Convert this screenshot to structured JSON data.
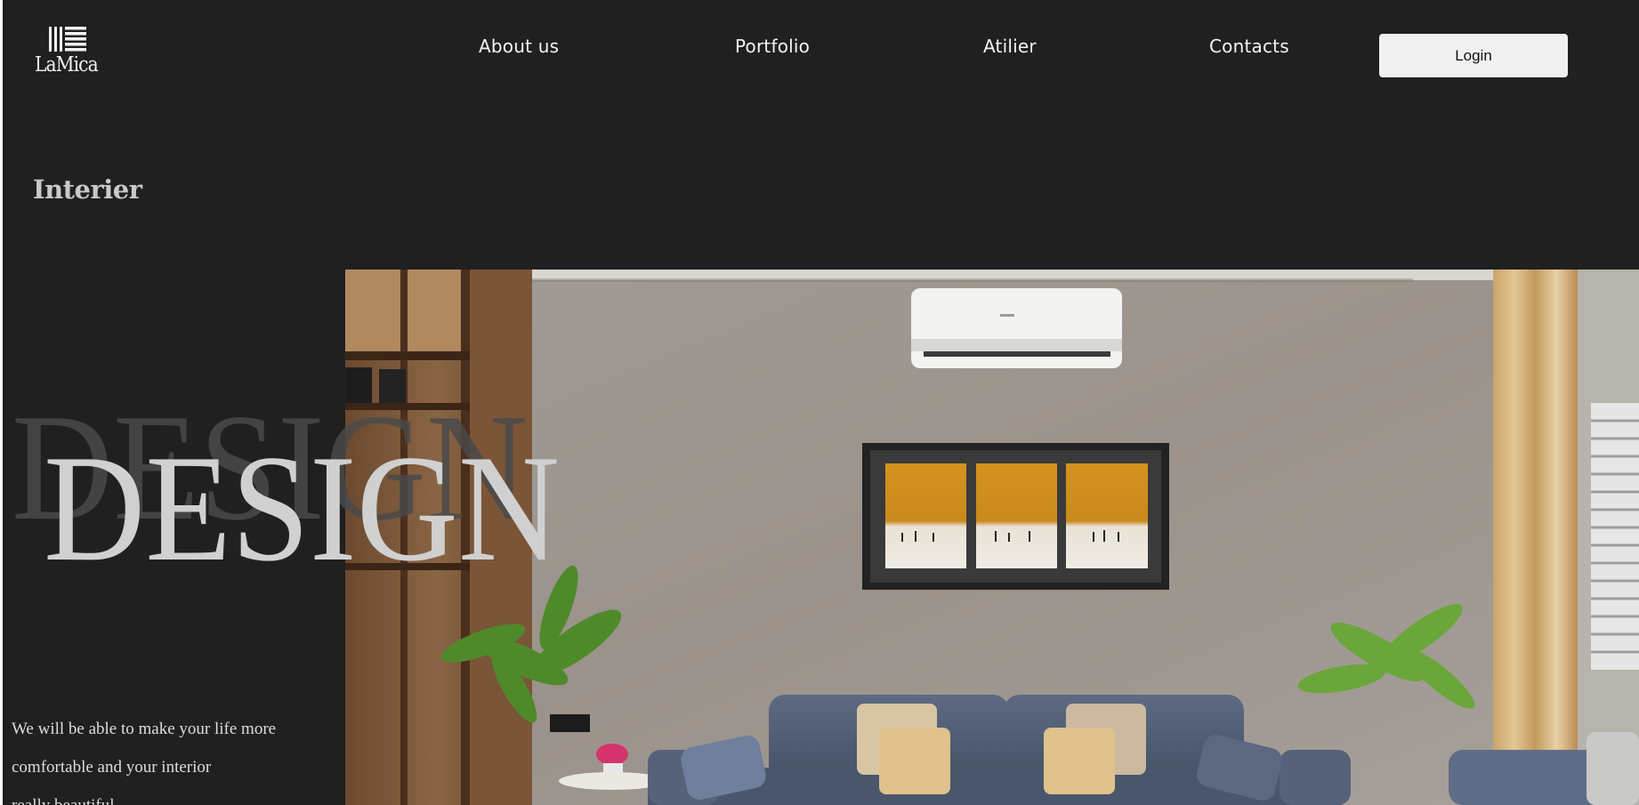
{
  "header": {
    "logo_text": "LaMica",
    "logo_icon": "stripes-logo-icon",
    "nav": [
      {
        "label": "About us"
      },
      {
        "label": "Portfolio"
      },
      {
        "label": "Atilier"
      },
      {
        "label": "Contacts"
      }
    ],
    "login_label": "Login"
  },
  "main": {
    "section_title": "Interier",
    "headline": "DESIGN",
    "headline_shadow": "DESIGN",
    "tagline_lines": [
      "We will be able to make your life more",
      "comfortable and your interior",
      "really beautiful"
    ]
  },
  "colors": {
    "background": "#202020",
    "text": "#f4f4f4",
    "muted_text": "#c9c9c9",
    "button": "#f0f0f0"
  }
}
